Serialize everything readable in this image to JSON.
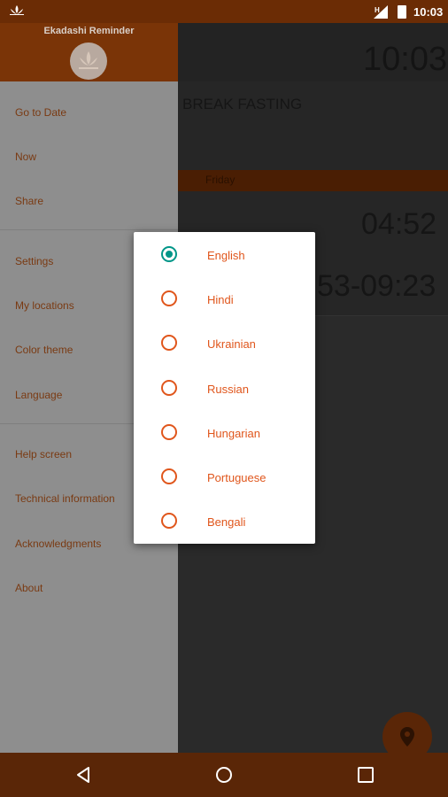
{
  "status_bar": {
    "time": "10:03"
  },
  "drawer": {
    "title": "Ekadashi Reminder",
    "items": [
      {
        "label": "Go to Date"
      },
      {
        "label": "Now"
      },
      {
        "label": "Share"
      },
      {
        "label": "Settings"
      },
      {
        "label": "My locations"
      },
      {
        "label": "Color theme"
      },
      {
        "label": "Language"
      },
      {
        "label": "Help screen"
      },
      {
        "label": "Technical information"
      },
      {
        "label": "Acknowledgments"
      },
      {
        "label": "About"
      }
    ]
  },
  "background": {
    "clock_large": "10:03",
    "fasting_label": "BREAK FASTING",
    "strip_label": "Friday",
    "time_1": "04:52",
    "time_range": "53-09:23"
  },
  "language_dialog": {
    "selected": "English",
    "options": [
      "English",
      "Hindi",
      "Ukrainian",
      "Russian",
      "Hungarian",
      "Portuguese",
      "Bengali"
    ]
  },
  "colors": {
    "primary": "#7a3407",
    "accent": "#e0561c",
    "radio_checked": "#009688"
  },
  "icons": {
    "status": [
      "lotus-icon",
      "signal-icon",
      "battery-icon"
    ],
    "nav": [
      "back-icon",
      "home-icon",
      "recents-icon"
    ],
    "fab": "location-pin-icon"
  }
}
